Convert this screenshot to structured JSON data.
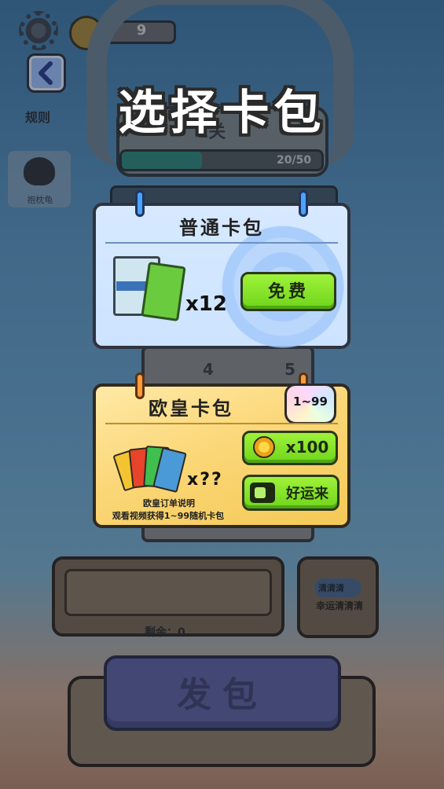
{
  "hud": {
    "coin_count": "9",
    "rules_label": "规则"
  },
  "level": {
    "title": "1关",
    "progress_text": "20/50",
    "progress_fraction": 0.4
  },
  "side_item": {
    "label": "抱枕龟"
  },
  "board": {
    "slot_4": "4",
    "slot_5": "5"
  },
  "tray": {
    "remaining_label": "剩余：0"
  },
  "clear_item": {
    "badge": "清清清",
    "label": "幸运清清清"
  },
  "deal_button": {
    "label": "发包"
  },
  "modal": {
    "title": "选择卡包",
    "normal_pack": {
      "title": "普通卡包",
      "quantity": "x12",
      "button_label": "免费"
    },
    "lucky_pack": {
      "title": "欧皇卡包",
      "badge": "1~99",
      "quantity": "x??",
      "description_title": "欧皇订单说明",
      "description": "观看视频获得1~99随机卡包",
      "coin_button_label": "x100",
      "video_button_label": "好运来"
    }
  },
  "colors": {
    "normal_card_bg": "#d6e9ff",
    "lucky_card_bg": "#fbd778",
    "button_green": "#8be82a",
    "overlay": "#141928"
  }
}
